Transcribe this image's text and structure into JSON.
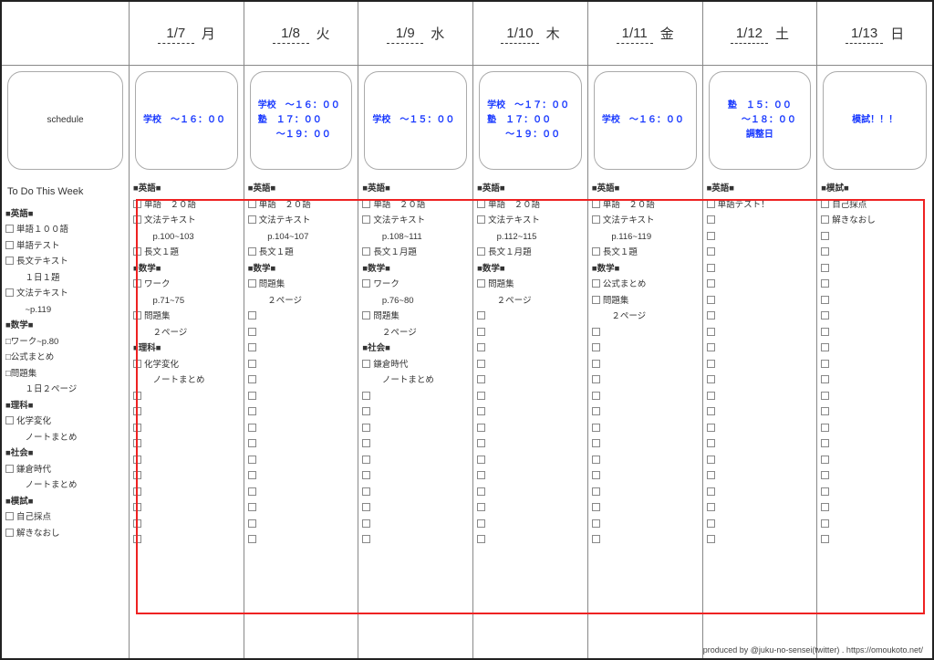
{
  "schedule_label": "schedule",
  "todo_this_week_label": "To Do This Week",
  "footer": "produced by @juku-no-sensei(twitter) . https://omoukoto.net/",
  "days": [
    {
      "date": "1/7",
      "dow": "月",
      "schedule": [
        "学校　～１６：００"
      ]
    },
    {
      "date": "1/8",
      "dow": "火",
      "schedule": [
        "学校　～１６：００",
        "塾　１７：００",
        "　　～１９：００"
      ]
    },
    {
      "date": "1/9",
      "dow": "水",
      "schedule": [
        "学校　～１５：００"
      ]
    },
    {
      "date": "1/10",
      "dow": "木",
      "schedule": [
        "学校　～１７：００",
        "塾　１７：００",
        "　　～１９：００"
      ]
    },
    {
      "date": "1/11",
      "dow": "金",
      "schedule": [
        "学校　～１６：００"
      ]
    },
    {
      "date": "1/12",
      "dow": "土",
      "schedule": [
        "塾　１５：００",
        "　　～１８：００",
        "調整日"
      ],
      "center": true
    },
    {
      "date": "1/13",
      "dow": "日",
      "schedule": [
        "模試！！！"
      ],
      "center": true
    }
  ],
  "sidebar": [
    {
      "type": "head",
      "text": "■英語■"
    },
    {
      "type": "item",
      "text": "単語１００語"
    },
    {
      "type": "item",
      "text": "単語テスト"
    },
    {
      "type": "item",
      "text": "長文テキスト"
    },
    {
      "type": "cont",
      "text": "１日１題"
    },
    {
      "type": "item",
      "text": "文法テキスト"
    },
    {
      "type": "cont",
      "text": "~p.119"
    },
    {
      "type": "head",
      "text": "■数学■"
    },
    {
      "type": "plain",
      "text": "□ワーク~p.80"
    },
    {
      "type": "plain",
      "text": "□公式まとめ"
    },
    {
      "type": "plain",
      "text": "□問題集"
    },
    {
      "type": "cont",
      "text": "１日２ページ"
    },
    {
      "type": "head",
      "text": "■理科■"
    },
    {
      "type": "item",
      "text": "化学変化"
    },
    {
      "type": "cont",
      "text": "ノートまとめ"
    },
    {
      "type": "head",
      "text": "■社会■"
    },
    {
      "type": "item",
      "text": "鎌倉時代"
    },
    {
      "type": "cont",
      "text": "ノートまとめ"
    },
    {
      "type": "head",
      "text": "■模試■"
    },
    {
      "type": "item",
      "text": "自己採点"
    },
    {
      "type": "item",
      "text": "解きなおし"
    }
  ],
  "day_todos": [
    [
      {
        "type": "head",
        "text": "■英語■"
      },
      {
        "type": "item",
        "text": "単語　２０語"
      },
      {
        "type": "item",
        "text": "文法テキスト"
      },
      {
        "type": "cont",
        "text": "p.100~103"
      },
      {
        "type": "item",
        "text": "長文１題"
      },
      {
        "type": "head",
        "text": "■数学■"
      },
      {
        "type": "item",
        "text": "ワーク"
      },
      {
        "type": "cont",
        "text": "p.71~75"
      },
      {
        "type": "item",
        "text": "問題集"
      },
      {
        "type": "cont",
        "text": "２ページ"
      },
      {
        "type": "head",
        "text": "■理科■"
      },
      {
        "type": "item",
        "text": "化学変化"
      },
      {
        "type": "cont",
        "text": "ノートまとめ"
      },
      {
        "type": "empty"
      },
      {
        "type": "empty"
      },
      {
        "type": "empty"
      },
      {
        "type": "empty"
      },
      {
        "type": "empty"
      },
      {
        "type": "empty"
      },
      {
        "type": "empty"
      },
      {
        "type": "empty"
      },
      {
        "type": "empty"
      },
      {
        "type": "empty"
      }
    ],
    [
      {
        "type": "head",
        "text": "■英語■"
      },
      {
        "type": "item",
        "text": "単語　２０語"
      },
      {
        "type": "item",
        "text": "文法テキスト"
      },
      {
        "type": "cont",
        "text": "p.104~107"
      },
      {
        "type": "item",
        "text": "長文１題"
      },
      {
        "type": "head",
        "text": "■数学■"
      },
      {
        "type": "item",
        "text": "問題集"
      },
      {
        "type": "cont",
        "text": "２ページ"
      },
      {
        "type": "empty"
      },
      {
        "type": "empty"
      },
      {
        "type": "empty"
      },
      {
        "type": "empty"
      },
      {
        "type": "empty"
      },
      {
        "type": "empty"
      },
      {
        "type": "empty"
      },
      {
        "type": "empty"
      },
      {
        "type": "empty"
      },
      {
        "type": "empty"
      },
      {
        "type": "empty"
      },
      {
        "type": "empty"
      },
      {
        "type": "empty"
      },
      {
        "type": "empty"
      },
      {
        "type": "empty"
      }
    ],
    [
      {
        "type": "head",
        "text": "■英語■"
      },
      {
        "type": "item",
        "text": "単語　２０語"
      },
      {
        "type": "item",
        "text": "文法テキスト"
      },
      {
        "type": "cont",
        "text": "p.108~111"
      },
      {
        "type": "item",
        "text": "長文１月題"
      },
      {
        "type": "head",
        "text": "■数学■"
      },
      {
        "type": "item",
        "text": "ワーク"
      },
      {
        "type": "cont",
        "text": "p.76~80"
      },
      {
        "type": "item",
        "text": "問題集"
      },
      {
        "type": "cont",
        "text": "２ページ"
      },
      {
        "type": "head",
        "text": "■社会■"
      },
      {
        "type": "item",
        "text": "鎌倉時代"
      },
      {
        "type": "cont",
        "text": "ノートまとめ"
      },
      {
        "type": "empty"
      },
      {
        "type": "empty"
      },
      {
        "type": "empty"
      },
      {
        "type": "empty"
      },
      {
        "type": "empty"
      },
      {
        "type": "empty"
      },
      {
        "type": "empty"
      },
      {
        "type": "empty"
      },
      {
        "type": "empty"
      },
      {
        "type": "empty"
      }
    ],
    [
      {
        "type": "head",
        "text": "■英語■"
      },
      {
        "type": "item",
        "text": "単語　２０語"
      },
      {
        "type": "item",
        "text": "文法テキスト"
      },
      {
        "type": "cont",
        "text": "p.112~115"
      },
      {
        "type": "item",
        "text": "長文１月題"
      },
      {
        "type": "head",
        "text": "■数学■"
      },
      {
        "type": "item",
        "text": "問題集"
      },
      {
        "type": "cont",
        "text": "２ページ"
      },
      {
        "type": "empty"
      },
      {
        "type": "empty"
      },
      {
        "type": "empty"
      },
      {
        "type": "empty"
      },
      {
        "type": "empty"
      },
      {
        "type": "empty"
      },
      {
        "type": "empty"
      },
      {
        "type": "empty"
      },
      {
        "type": "empty"
      },
      {
        "type": "empty"
      },
      {
        "type": "empty"
      },
      {
        "type": "empty"
      },
      {
        "type": "empty"
      },
      {
        "type": "empty"
      },
      {
        "type": "empty"
      }
    ],
    [
      {
        "type": "head",
        "text": "■英語■"
      },
      {
        "type": "item",
        "text": "単語　２０語"
      },
      {
        "type": "item",
        "text": "文法テキスト"
      },
      {
        "type": "cont",
        "text": "p.116~119"
      },
      {
        "type": "item",
        "text": "長文１題"
      },
      {
        "type": "head",
        "text": "■数学■"
      },
      {
        "type": "item",
        "text": "公式まとめ"
      },
      {
        "type": "item",
        "text": "問題集"
      },
      {
        "type": "cont",
        "text": "２ページ"
      },
      {
        "type": "empty"
      },
      {
        "type": "empty"
      },
      {
        "type": "empty"
      },
      {
        "type": "empty"
      },
      {
        "type": "empty"
      },
      {
        "type": "empty"
      },
      {
        "type": "empty"
      },
      {
        "type": "empty"
      },
      {
        "type": "empty"
      },
      {
        "type": "empty"
      },
      {
        "type": "empty"
      },
      {
        "type": "empty"
      },
      {
        "type": "empty"
      },
      {
        "type": "empty"
      }
    ],
    [
      {
        "type": "head",
        "text": "■英語■"
      },
      {
        "type": "item",
        "text": "単語テスト！"
      },
      {
        "type": "empty"
      },
      {
        "type": "empty"
      },
      {
        "type": "empty"
      },
      {
        "type": "empty"
      },
      {
        "type": "empty"
      },
      {
        "type": "empty"
      },
      {
        "type": "empty"
      },
      {
        "type": "empty"
      },
      {
        "type": "empty"
      },
      {
        "type": "empty"
      },
      {
        "type": "empty"
      },
      {
        "type": "empty"
      },
      {
        "type": "empty"
      },
      {
        "type": "empty"
      },
      {
        "type": "empty"
      },
      {
        "type": "empty"
      },
      {
        "type": "empty"
      },
      {
        "type": "empty"
      },
      {
        "type": "empty"
      },
      {
        "type": "empty"
      },
      {
        "type": "empty"
      }
    ],
    [
      {
        "type": "head",
        "text": "■模試■"
      },
      {
        "type": "item",
        "text": "自己採点"
      },
      {
        "type": "item",
        "text": "解きなおし"
      },
      {
        "type": "empty"
      },
      {
        "type": "empty"
      },
      {
        "type": "empty"
      },
      {
        "type": "empty"
      },
      {
        "type": "empty"
      },
      {
        "type": "empty"
      },
      {
        "type": "empty"
      },
      {
        "type": "empty"
      },
      {
        "type": "empty"
      },
      {
        "type": "empty"
      },
      {
        "type": "empty"
      },
      {
        "type": "empty"
      },
      {
        "type": "empty"
      },
      {
        "type": "empty"
      },
      {
        "type": "empty"
      },
      {
        "type": "empty"
      },
      {
        "type": "empty"
      },
      {
        "type": "empty"
      },
      {
        "type": "empty"
      },
      {
        "type": "empty"
      }
    ]
  ]
}
